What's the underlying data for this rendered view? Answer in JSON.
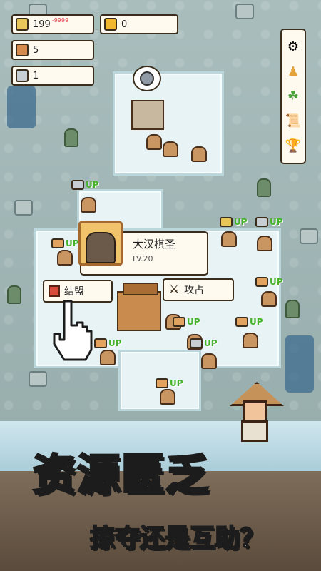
{
  "resources": {
    "wheat": {
      "value": "199",
      "sub": "-9999",
      "icon": "wheat-icon"
    },
    "coins": {
      "value": "0",
      "icon": "coin-icon"
    },
    "wood": {
      "value": "5",
      "icon": "log-icon"
    },
    "stone": {
      "value": "1",
      "icon": "stone-icon"
    }
  },
  "sidebar": [
    {
      "icon": "settings-icon",
      "glyph": "⚙"
    },
    {
      "icon": "leader-icon",
      "glyph": "♟"
    },
    {
      "icon": "alliance-icon",
      "glyph": "☘"
    },
    {
      "icon": "scroll-icon",
      "glyph": "📜"
    },
    {
      "icon": "trophy-icon",
      "glyph": "🏆"
    }
  ],
  "selected_player": {
    "name": "大汉棋圣",
    "level": "LV.20"
  },
  "actions": {
    "ally": "结盟",
    "attack": "攻占"
  },
  "upgrade_label": "UP",
  "banner": {
    "headline": "资源匮乏",
    "subline": "掠夺还是互助？"
  },
  "colors": {
    "upgrade_green": "#46b22c",
    "headline_yellow": "#ffd84a",
    "headline_blue": "#4aa9ff"
  }
}
